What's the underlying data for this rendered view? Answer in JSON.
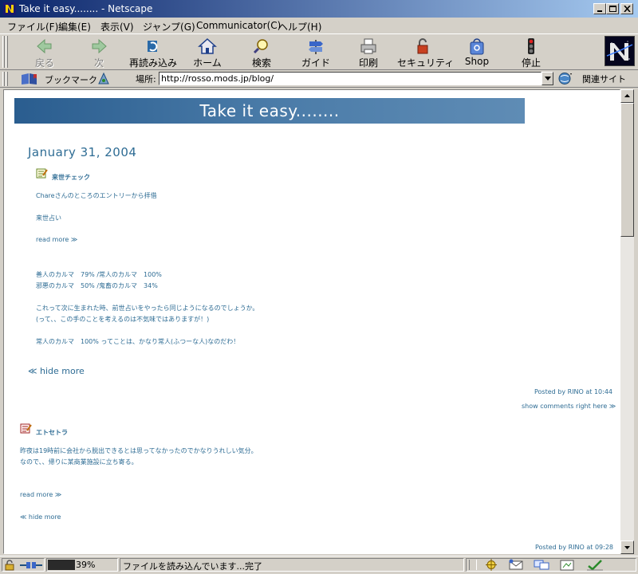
{
  "window": {
    "title": "Take it easy........ - Netscape"
  },
  "menu": [
    "ファイル(F)",
    "編集(E)",
    "表示(V)",
    "ジャンプ(G)",
    "Communicator(C)",
    "ヘルプ(H)"
  ],
  "toolbar": {
    "back": "戻る",
    "forward": "次",
    "reload": "再読み込み",
    "home": "ホーム",
    "search": "検索",
    "guide": "ガイド",
    "print": "印刷",
    "security": "セキュリティ",
    "shop": "Shop",
    "stop": "停止"
  },
  "location": {
    "bookmarks_label": "ブックマーク",
    "location_label": "場所:",
    "url": "http://rosso.mods.jp/blog/",
    "related_label": "関連サイト"
  },
  "page": {
    "banner_title": "Take it easy........",
    "date_header": "January 31, 2004",
    "post1": {
      "title": "来世チェック",
      "line1": "Chareさんのところのエントリーから拝借",
      "line2": "来世占い",
      "read_more": "read more ≫",
      "karma1": "善人のカルマ　79% /常人のカルマ　100%",
      "karma2": "邪悪のカルマ　50% /鬼畜のカルマ　34%",
      "para1": "これって次に生まれた時、前世占いをやったら同じようになるのでしょうか。",
      "para2": "(って、、この手のことを考えるのは不気味ではありますが！)",
      "para3": "常人のカルマ　100% ってことは、かなり常人(ふつーな人)なのだわ！",
      "hide_more": "≪ hide more",
      "posted": "Posted by RINO at 10:44",
      "comments": "show comments right here ≫"
    },
    "post2": {
      "title": "エトセトラ",
      "line1": "昨夜は19時前に会社から脱出できるとは思ってなかったのでかなりうれしい気分。",
      "line2": "なので、、帰りに某商業施設に立ち寄る。",
      "read_more": "read more ≫",
      "hide_more": "≪ hide more",
      "posted": "Posted by RINO at 09:28"
    }
  },
  "status": {
    "progress_percent": 39,
    "progress_text": "39%",
    "message": "ファイルを読み込んでいます...完了"
  },
  "colors": {
    "link": "#2e6c94",
    "banner": "#3b6c9b",
    "titlebar": "#0a246a"
  }
}
